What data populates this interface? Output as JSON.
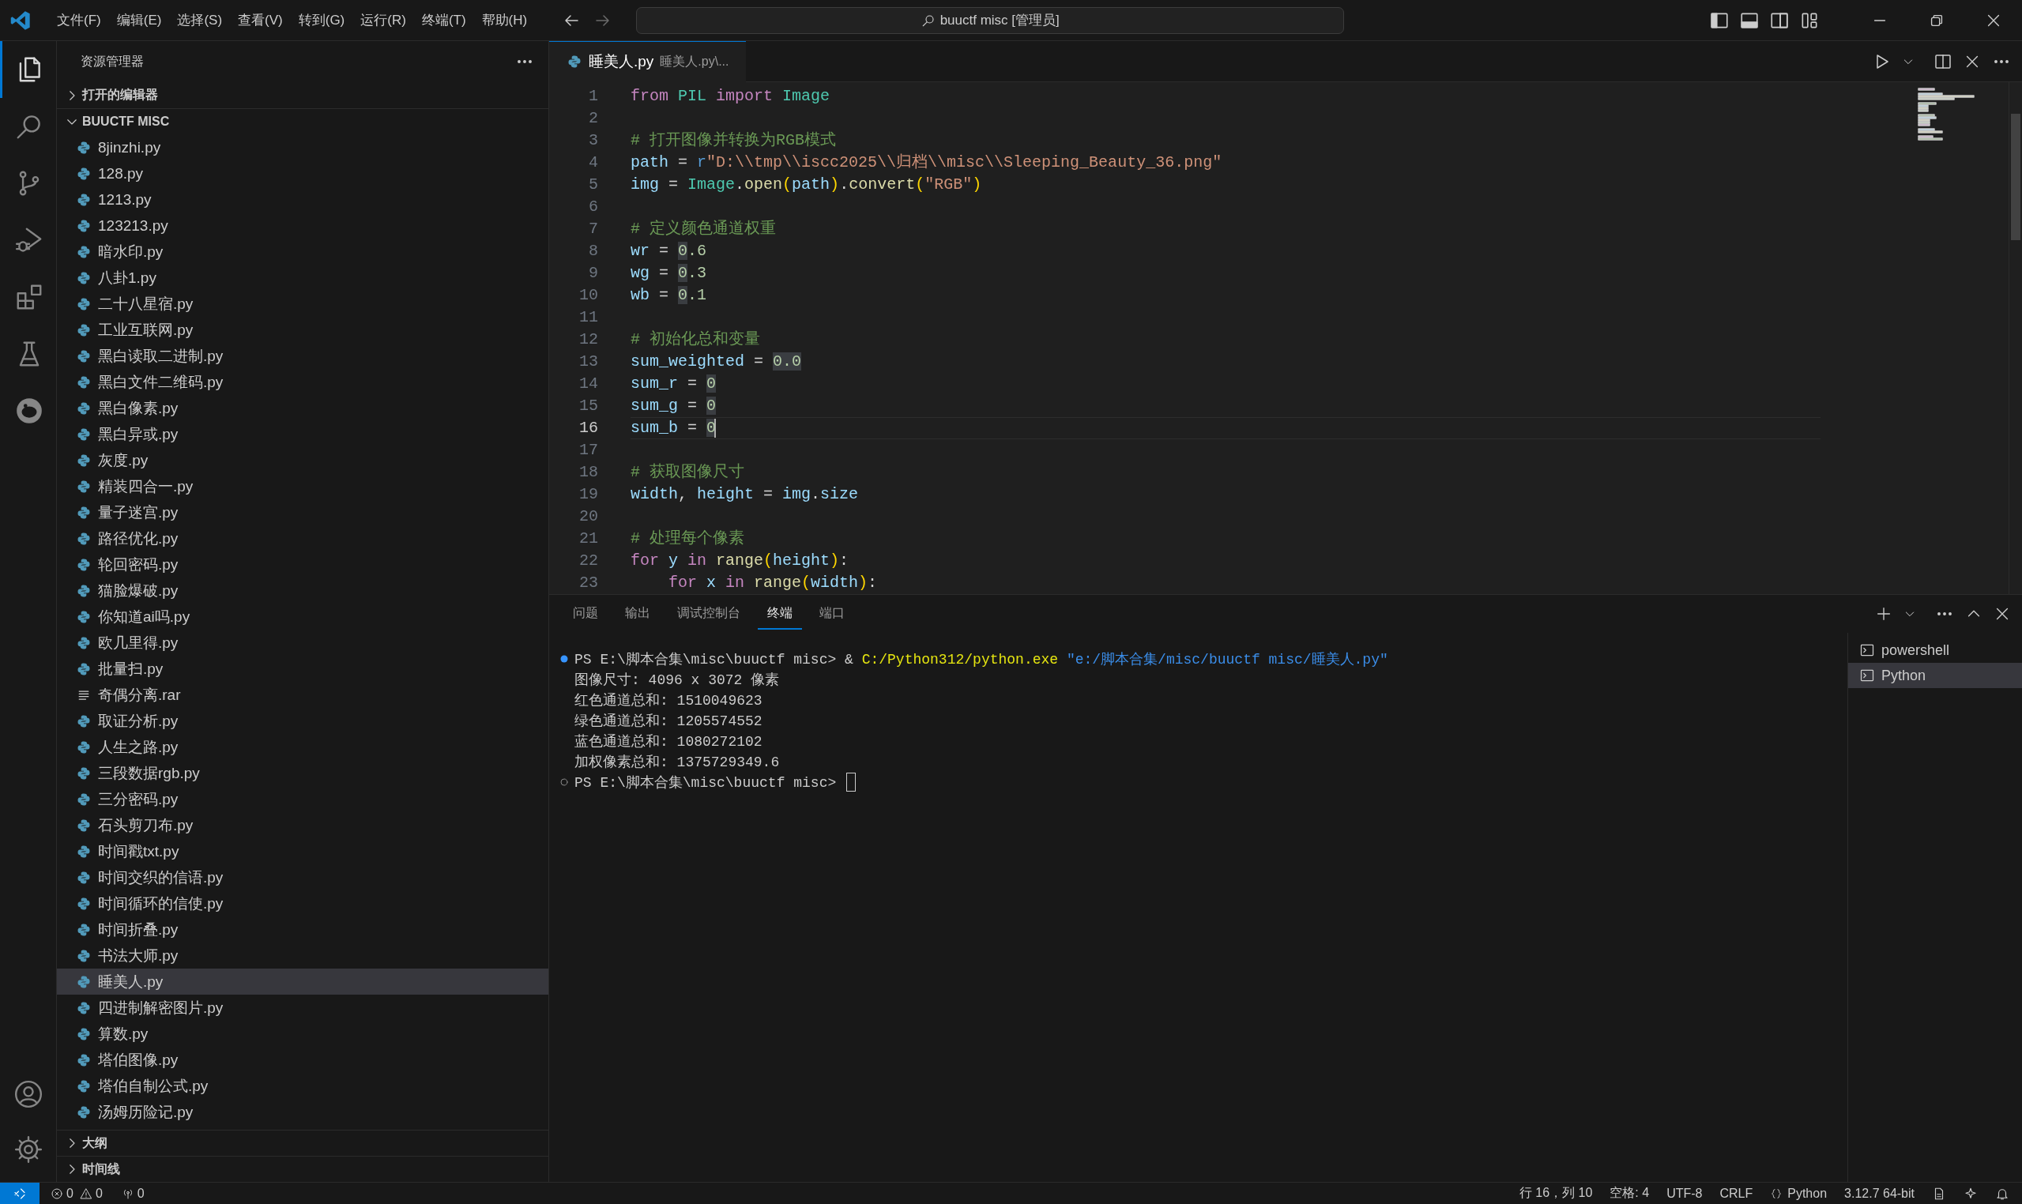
{
  "title_bar": {
    "menus": [
      "文件(F)",
      "编辑(E)",
      "选择(S)",
      "查看(V)",
      "转到(G)",
      "运行(R)",
      "终端(T)",
      "帮助(H)"
    ],
    "command_center": "buuctf misc [管理员]",
    "layout_toggles": [
      {
        "kind": "primary-sidebar",
        "on": true
      },
      {
        "kind": "panel",
        "on": true
      },
      {
        "kind": "secondary-sidebar",
        "on": false
      }
    ]
  },
  "activity_bar": [
    {
      "kind": "explorer",
      "selected": true
    },
    {
      "kind": "search",
      "selected": false
    },
    {
      "kind": "source-control",
      "selected": false
    },
    {
      "kind": "run-debug",
      "selected": false
    },
    {
      "kind": "extensions",
      "selected": false
    },
    {
      "kind": "testing",
      "selected": false
    },
    {
      "kind": "pig",
      "selected": false
    }
  ],
  "explorer": {
    "title": "资源管理器",
    "sections": [
      {
        "label": "打开的编辑器",
        "expanded": false
      },
      {
        "label": "BUUCTF MISC",
        "expanded": true
      }
    ],
    "files": [
      {
        "name": "8jinzhi.py",
        "kind": "python",
        "selected": false
      },
      {
        "name": "128.py",
        "kind": "python",
        "selected": false
      },
      {
        "name": "1213.py",
        "kind": "python",
        "selected": false
      },
      {
        "name": "123213.py",
        "kind": "python",
        "selected": false
      },
      {
        "name": "暗水印.py",
        "kind": "python",
        "selected": false
      },
      {
        "name": "八卦1.py",
        "kind": "python",
        "selected": false
      },
      {
        "name": "二十八星宿.py",
        "kind": "python",
        "selected": false
      },
      {
        "name": "工业互联网.py",
        "kind": "python",
        "selected": false
      },
      {
        "name": "黑白读取二进制.py",
        "kind": "python",
        "selected": false
      },
      {
        "name": "黑白文件二维码.py",
        "kind": "python",
        "selected": false
      },
      {
        "name": "黑白像素.py",
        "kind": "python",
        "selected": false
      },
      {
        "name": "黑白异或.py",
        "kind": "python",
        "selected": false
      },
      {
        "name": "灰度.py",
        "kind": "python",
        "selected": false
      },
      {
        "name": "精装四合一.py",
        "kind": "python",
        "selected": false
      },
      {
        "name": "量子迷宫.py",
        "kind": "python",
        "selected": false
      },
      {
        "name": "路径优化.py",
        "kind": "python",
        "selected": false
      },
      {
        "name": "轮回密码.py",
        "kind": "python",
        "selected": false
      },
      {
        "name": "猫脸爆破.py",
        "kind": "python",
        "selected": false
      },
      {
        "name": "你知道ai吗.py",
        "kind": "python",
        "selected": false
      },
      {
        "name": "欧几里得.py",
        "kind": "python",
        "selected": false
      },
      {
        "name": "批量扫.py",
        "kind": "python",
        "selected": false
      },
      {
        "name": "奇偶分离.rar",
        "kind": "archive",
        "selected": false
      },
      {
        "name": "取证分析.py",
        "kind": "python",
        "selected": false
      },
      {
        "name": "人生之路.py",
        "kind": "python",
        "selected": false
      },
      {
        "name": "三段数据rgb.py",
        "kind": "python",
        "selected": false
      },
      {
        "name": "三分密码.py",
        "kind": "python",
        "selected": false
      },
      {
        "name": "石头剪刀布.py",
        "kind": "python",
        "selected": false
      },
      {
        "name": "时间戳txt.py",
        "kind": "python",
        "selected": false
      },
      {
        "name": "时间交织的信语.py",
        "kind": "python",
        "selected": false
      },
      {
        "name": "时间循环的信使.py",
        "kind": "python",
        "selected": false
      },
      {
        "name": "时间折叠.py",
        "kind": "python",
        "selected": false
      },
      {
        "name": "书法大师.py",
        "kind": "python",
        "selected": false
      },
      {
        "name": "睡美人.py",
        "kind": "python",
        "selected": true
      },
      {
        "name": "四进制解密图片.py",
        "kind": "python",
        "selected": false
      },
      {
        "name": "算数.py",
        "kind": "python",
        "selected": false
      },
      {
        "name": "塔伯图像.py",
        "kind": "python",
        "selected": false
      },
      {
        "name": "塔伯自制公式.py",
        "kind": "python",
        "selected": false
      },
      {
        "name": "汤姆历险记.py",
        "kind": "python",
        "selected": false
      }
    ],
    "bottom_sections": [
      {
        "label": "大纲",
        "expanded": false
      },
      {
        "label": "时间线",
        "expanded": false
      }
    ]
  },
  "editor": {
    "tab": {
      "title": "睡美人.py",
      "description": "睡美人.py\\..."
    },
    "lines": [
      {
        "number": "1",
        "current": false,
        "tokens": [
          {
            "text": "from ",
            "kind": "keyword"
          },
          {
            "text": "PIL ",
            "kind": "class"
          },
          {
            "text": "import ",
            "kind": "keyword"
          },
          {
            "text": "Image",
            "kind": "class"
          }
        ]
      },
      {
        "number": "2",
        "current": false
      },
      {
        "number": "3",
        "current": false,
        "tokens": [
          {
            "text": "# 打开图像并转换为RGB模式",
            "kind": "comment"
          }
        ]
      },
      {
        "number": "4",
        "current": false,
        "tokens": [
          {
            "text": "path",
            "kind": "variable"
          },
          {
            "text": " = ",
            "kind": "plain"
          },
          {
            "text": "r",
            "kind": "storage"
          },
          {
            "text": "\"D:\\\\tmp\\\\iscc2025\\\\归档\\\\misc\\\\Sleeping_Beauty_36.png\"",
            "kind": "string"
          }
        ]
      },
      {
        "number": "5",
        "current": false,
        "tokens": [
          {
            "text": "img",
            "kind": "variable"
          },
          {
            "text": " = ",
            "kind": "plain"
          },
          {
            "text": "Image",
            "kind": "class"
          },
          {
            "text": ".",
            "kind": "plain"
          },
          {
            "text": "open",
            "kind": "function"
          },
          {
            "text": "(",
            "kind": "bracket"
          },
          {
            "text": "path",
            "kind": "variable"
          },
          {
            "text": ")",
            "kind": "bracket"
          },
          {
            "text": ".",
            "kind": "plain"
          },
          {
            "text": "convert",
            "kind": "function"
          },
          {
            "text": "(",
            "kind": "bracket"
          },
          {
            "text": "\"RGB\"",
            "kind": "string"
          },
          {
            "text": ")",
            "kind": "bracket"
          }
        ]
      },
      {
        "number": "6",
        "current": false
      },
      {
        "number": "7",
        "current": false,
        "tokens": [
          {
            "text": "# 定义颜色通道权重",
            "kind": "comment"
          }
        ]
      },
      {
        "number": "8",
        "current": false,
        "tokens": [
          {
            "text": "wr",
            "kind": "variable"
          },
          {
            "text": " = ",
            "kind": "plain"
          },
          {
            "text": "0",
            "kind": "number",
            "highlight": true
          },
          {
            "text": ".6",
            "kind": "number"
          }
        ]
      },
      {
        "number": "9",
        "current": false,
        "tokens": [
          {
            "text": "wg",
            "kind": "variable"
          },
          {
            "text": " = ",
            "kind": "plain"
          },
          {
            "text": "0",
            "kind": "number",
            "highlight": true
          },
          {
            "text": ".3",
            "kind": "number"
          }
        ]
      },
      {
        "number": "10",
        "current": false,
        "tokens": [
          {
            "text": "wb",
            "kind": "variable"
          },
          {
            "text": " = ",
            "kind": "plain"
          },
          {
            "text": "0",
            "kind": "number",
            "highlight": true
          },
          {
            "text": ".1",
            "kind": "number"
          }
        ]
      },
      {
        "number": "11",
        "current": false
      },
      {
        "number": "12",
        "current": false,
        "tokens": [
          {
            "text": "# 初始化总和变量",
            "kind": "comment"
          }
        ]
      },
      {
        "number": "13",
        "current": false,
        "tokens": [
          {
            "text": "sum_weighted",
            "kind": "variable"
          },
          {
            "text": " = ",
            "kind": "plain"
          },
          {
            "text": "0.0",
            "kind": "number",
            "highlight": true
          }
        ]
      },
      {
        "number": "14",
        "current": false,
        "tokens": [
          {
            "text": "sum_r",
            "kind": "variable"
          },
          {
            "text": " = ",
            "kind": "plain"
          },
          {
            "text": "0",
            "kind": "number",
            "highlight": true
          }
        ]
      },
      {
        "number": "15",
        "current": false,
        "tokens": [
          {
            "text": "sum_g",
            "kind": "variable"
          },
          {
            "text": " = ",
            "kind": "plain"
          },
          {
            "text": "0",
            "kind": "number",
            "highlight": true
          }
        ]
      },
      {
        "number": "16",
        "current": true,
        "tokens": [
          {
            "text": "sum_b",
            "kind": "variable"
          },
          {
            "text": " = ",
            "kind": "plain"
          },
          {
            "text": "0",
            "kind": "number",
            "highlight": true
          }
        ]
      },
      {
        "number": "17",
        "current": false
      },
      {
        "number": "18",
        "current": false,
        "tokens": [
          {
            "text": "# 获取图像尺寸",
            "kind": "comment"
          }
        ]
      },
      {
        "number": "19",
        "current": false,
        "tokens": [
          {
            "text": "width",
            "kind": "variable"
          },
          {
            "text": ", ",
            "kind": "plain"
          },
          {
            "text": "height",
            "kind": "variable"
          },
          {
            "text": " = ",
            "kind": "plain"
          },
          {
            "text": "img",
            "kind": "variable"
          },
          {
            "text": ".",
            "kind": "plain"
          },
          {
            "text": "size",
            "kind": "variable"
          }
        ]
      },
      {
        "number": "20",
        "current": false
      },
      {
        "number": "21",
        "current": false,
        "tokens": [
          {
            "text": "# 处理每个像素",
            "kind": "comment"
          }
        ]
      },
      {
        "number": "22",
        "current": false,
        "tokens": [
          {
            "text": "for ",
            "kind": "keyword"
          },
          {
            "text": "y ",
            "kind": "variable"
          },
          {
            "text": "in ",
            "kind": "keyword"
          },
          {
            "text": "range",
            "kind": "function"
          },
          {
            "text": "(",
            "kind": "bracket"
          },
          {
            "text": "height",
            "kind": "variable"
          },
          {
            "text": ")",
            "kind": "bracket"
          },
          {
            "text": ":",
            "kind": "plain"
          }
        ]
      },
      {
        "number": "23",
        "current": false,
        "tokens": [
          {
            "text": "    for ",
            "kind": "keyword"
          },
          {
            "text": "x ",
            "kind": "variable"
          },
          {
            "text": "in ",
            "kind": "keyword"
          },
          {
            "text": "range",
            "kind": "function"
          },
          {
            "text": "(",
            "kind": "bracket"
          },
          {
            "text": "width",
            "kind": "variable"
          },
          {
            "text": ")",
            "kind": "bracket"
          },
          {
            "text": ":",
            "kind": "plain"
          }
        ]
      }
    ]
  },
  "panel": {
    "tabs": [
      {
        "label": "问题",
        "selected": false
      },
      {
        "label": "输出",
        "selected": false
      },
      {
        "label": "调试控制台",
        "selected": false
      },
      {
        "label": "终端",
        "selected": true
      },
      {
        "label": "端口",
        "selected": false
      }
    ],
    "terminal": [
      {
        "kind": "command",
        "finished": true,
        "cursor": false,
        "tokens": [
          {
            "text": "PS E:\\脚本合集\\misc\\buuctf misc> & ",
            "kind": "plain"
          },
          {
            "text": "C:/Python312/python.exe ",
            "kind": "command"
          },
          {
            "text": "\"e:/脚本合集/misc/buuctf misc/睡美人.py\"",
            "kind": "string"
          }
        ]
      },
      {
        "kind": "output",
        "cursor": false,
        "tokens": [
          {
            "text": "图像尺寸: 4096 x 3072 像素",
            "kind": "plain"
          }
        ]
      },
      {
        "kind": "output",
        "cursor": false,
        "tokens": [
          {
            "text": "红色通道总和: 1510049623",
            "kind": "plain"
          }
        ]
      },
      {
        "kind": "output",
        "cursor": false,
        "tokens": [
          {
            "text": "绿色通道总和: 1205574552",
            "kind": "plain"
          }
        ]
      },
      {
        "kind": "output",
        "cursor": false,
        "tokens": [
          {
            "text": "蓝色通道总和: 1080272102",
            "kind": "plain"
          }
        ]
      },
      {
        "kind": "output",
        "cursor": false,
        "tokens": [
          {
            "text": "加权像素总和: 1375729349.6",
            "kind": "plain"
          }
        ]
      },
      {
        "kind": "command",
        "finished": false,
        "cursor": true,
        "tokens": [
          {
            "text": "PS E:\\脚本合集\\misc\\buuctf misc> ",
            "kind": "plain"
          }
        ]
      }
    ],
    "terminals": [
      {
        "name": "powershell",
        "selected": false
      },
      {
        "name": "Python",
        "selected": true
      }
    ]
  },
  "status_bar": {
    "errors": "0",
    "warnings": "0",
    "ports": "0",
    "position": "行 16，列 10",
    "indent": "空格: 4",
    "encoding": "UTF-8",
    "eol": "CRLF",
    "language": "Python",
    "interpreter": "3.12.7 64-bit"
  }
}
